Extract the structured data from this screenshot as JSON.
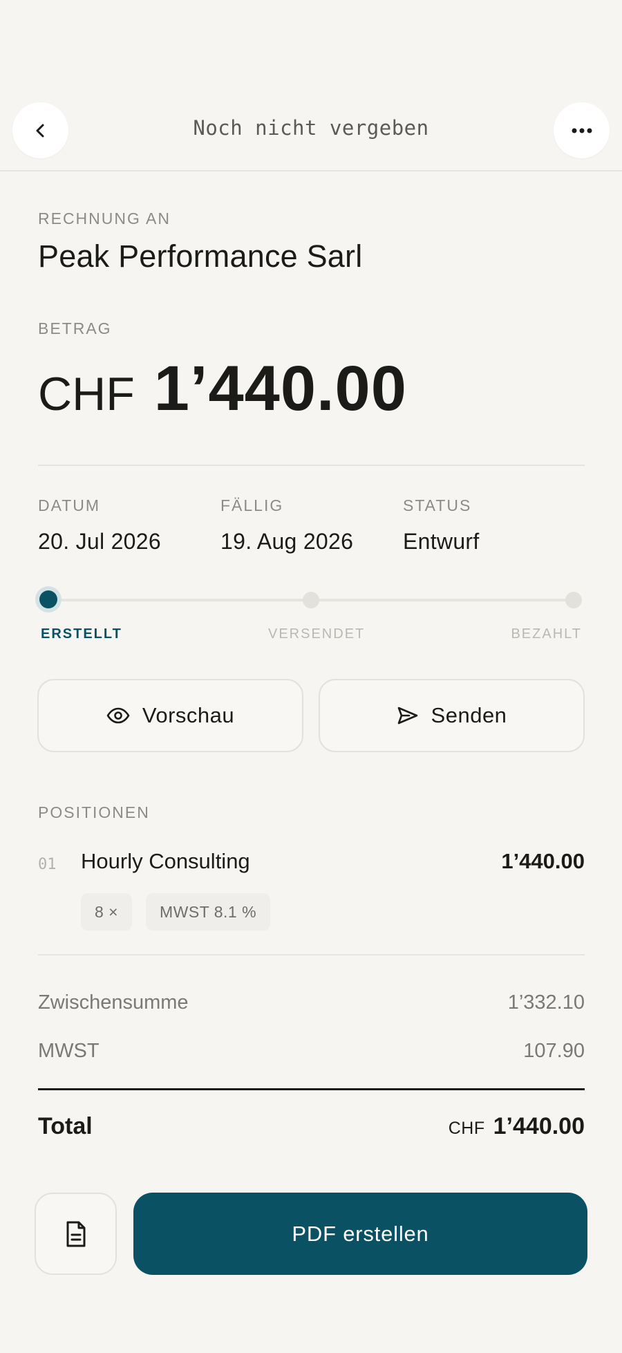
{
  "header": {
    "title": "Noch nicht vergeben",
    "back_icon": "chevron-left-icon",
    "more_icon": "more-horizontal-icon"
  },
  "client": {
    "label": "RECHNUNG AN",
    "name": "Peak Performance Sarl"
  },
  "amount": {
    "label": "BETRAG",
    "currency": "CHF",
    "value": "1’440.00"
  },
  "meta": {
    "date_label": "DATUM",
    "date_value": "20. Jul 2026",
    "due_label": "FÄLLIG",
    "due_value": "19. Aug 2026",
    "status_label": "STATUS",
    "status_value": "Entwurf"
  },
  "progress": {
    "steps": [
      {
        "label": "ERSTELLT",
        "active": true
      },
      {
        "label": "VERSENDET",
        "active": false
      },
      {
        "label": "BEZAHLT",
        "active": false
      }
    ]
  },
  "actions": {
    "preview_label": "Vorschau",
    "send_label": "Senden"
  },
  "positions": {
    "label": "POSITIONEN",
    "items": [
      {
        "number": "01",
        "name": "Hourly Consulting",
        "amount": "1’440.00",
        "quantity": "8 ×",
        "vat": "MWST 8.1 %"
      }
    ]
  },
  "summary": {
    "subtotal_label": "Zwischensumme",
    "subtotal_value": "1’332.10",
    "vat_label": "MWST",
    "vat_value": "107.90",
    "total_label": "Total",
    "total_currency": "CHF",
    "total_value": "1’440.00"
  },
  "footer": {
    "pdf_label": "PDF erstellen",
    "doc_icon": "document-icon"
  },
  "colors": {
    "accent": "#0a5263",
    "background": "#f6f5f2",
    "text": "#1b1b1a",
    "muted": "#8c8b87"
  }
}
